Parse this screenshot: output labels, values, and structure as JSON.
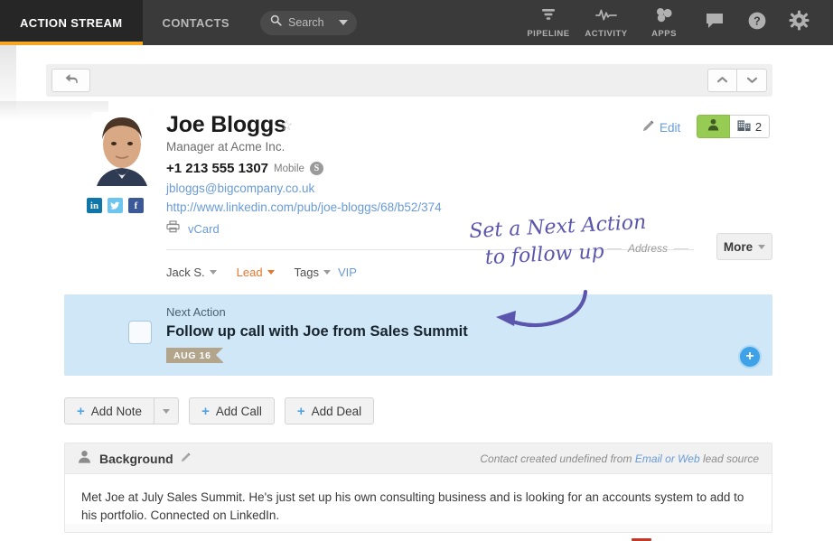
{
  "topnav": {
    "tabs": [
      {
        "label": "ACTION STREAM",
        "active": true
      },
      {
        "label": "CONTACTS",
        "active": false
      }
    ],
    "search": {
      "placeholder": "Search",
      "icon": "search-icon"
    },
    "icon_items": [
      {
        "label": "PIPELINE",
        "icon": "funnel-icon"
      },
      {
        "label": "ACTIVITY",
        "icon": "pulse-icon"
      },
      {
        "label": "APPS",
        "icon": "apps-icon"
      }
    ],
    "plain_icons": [
      {
        "icon": "chat-bubble-icon"
      },
      {
        "icon": "help-circle-icon"
      },
      {
        "icon": "gear-icon"
      }
    ],
    "accent_color": "#f5a623",
    "bg_color": "#3a3a3a"
  },
  "toolbar": {
    "back_icon": "back-arrow-icon",
    "prev_icon": "chevron-up-icon",
    "next_icon": "chevron-down-icon"
  },
  "contact": {
    "name": "Joe Bloggs",
    "star_icon": "star-outline-icon",
    "role": "Manager at Acme Inc.",
    "phone": "+1 213 555 1307",
    "phone_type": "Mobile",
    "skype_icon": "skype-icon",
    "skype_letter": "S",
    "email": "jbloggs@bigcompany.co.uk",
    "website": "http://www.linkedin.com/pub/joe-bloggs/68/b52/374",
    "vcard_label": "vCard",
    "vcard_icon": "printer-icon",
    "avatar_name": "contact-photo",
    "social": [
      {
        "name": "linkedin-icon",
        "letter": "in",
        "color": "#0e76a8"
      },
      {
        "name": "twitter-icon",
        "letter": "t",
        "color": "#6cc5ee"
      },
      {
        "name": "facebook-icon",
        "letter": "f",
        "color": "#3b5998"
      }
    ],
    "owner": "Jack S.",
    "status": "Lead",
    "status_color": "#e8772e",
    "tags_label": "Tags",
    "tag_value": "VIP",
    "edit_label": "Edit",
    "edit_icon": "pencil-icon",
    "person_toggle_icon": "person-icon",
    "company_toggle_icon": "building-icon",
    "company_count": "2",
    "address_label": "Address",
    "more_label": "More"
  },
  "annotation": {
    "line1": "Set a Next Action",
    "line2": "to follow up",
    "color": "#5b56ad",
    "arrow_icon": "curved-arrow-icon"
  },
  "next_action": {
    "label": "Next Action",
    "title": "Follow up call with Joe from Sales Summit",
    "date": "AUG 16",
    "checkbox_name": "next-action-checkbox",
    "add_icon": "plus-circle-icon",
    "bg_color": "#cfe7f7",
    "date_color": "#b3a58c"
  },
  "actions": [
    {
      "label": "Add Note",
      "icon": "plus-icon",
      "has_dropdown": true
    },
    {
      "label": "Add Call",
      "icon": "plus-icon",
      "has_dropdown": false
    },
    {
      "label": "Add Deal",
      "icon": "plus-icon",
      "has_dropdown": false
    }
  ],
  "background": {
    "title": "Background",
    "person_icon": "person-icon",
    "edit_icon": "pencil-icon",
    "meta_prefix": "Contact created undefined from ",
    "meta_link": "Email or Web",
    "meta_suffix": " lead source",
    "body": "Met Joe at July Sales Summit. He's just set up his own consulting business and is looking for an accounts system to add to his portfolio. Connected on LinkedIn."
  }
}
